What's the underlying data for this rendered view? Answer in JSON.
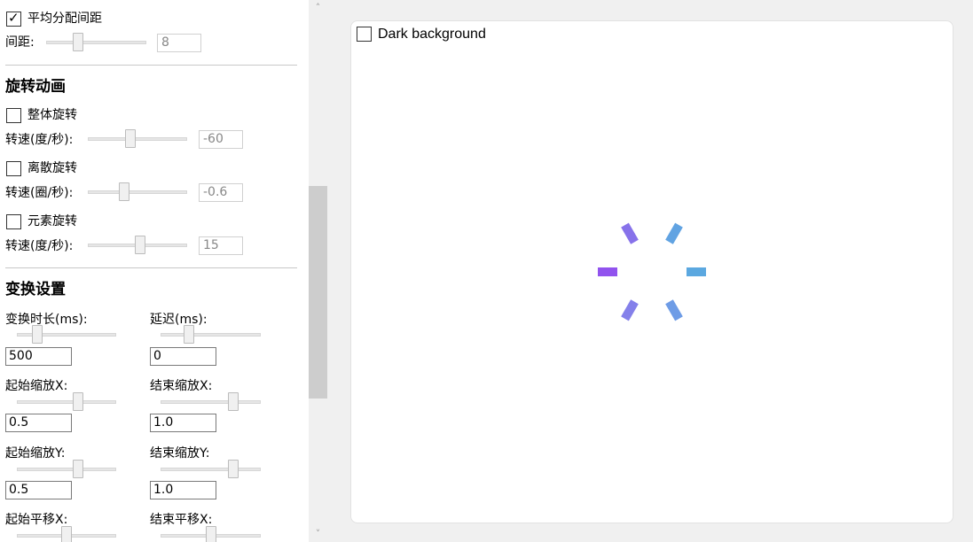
{
  "panel": {
    "even_spacing": {
      "label": "平均分配间距",
      "checked": true
    },
    "spacing": {
      "label": "间距:",
      "value": "8",
      "level": 0.3
    },
    "rotation_section": {
      "title": "旋转动画"
    },
    "whole_rotation": {
      "label": "整体旋转",
      "checked": false
    },
    "whole_speed": {
      "label": "转速(度/秒):",
      "value": "-60",
      "level": 0.42
    },
    "discrete_rotation": {
      "label": "离散旋转",
      "checked": false
    },
    "discrete_speed": {
      "label": "转速(圈/秒):",
      "value": "-0.6",
      "level": 0.35
    },
    "element_rotation": {
      "label": "元素旋转",
      "checked": false
    },
    "element_speed": {
      "label": "转速(度/秒):",
      "value": "15",
      "level": 0.53
    },
    "transform_section": {
      "title": "变换设置"
    },
    "duration": {
      "label": "变换时长(ms):",
      "value": "500",
      "level": 0.17
    },
    "delay": {
      "label": "延迟(ms):",
      "value": "0",
      "level": 0.26
    },
    "start_scale_x": {
      "label": "起始缩放X:",
      "value": "0.5",
      "level": 0.63
    },
    "end_scale_x": {
      "label": "结束缩放X:",
      "value": "1.0",
      "level": 0.75
    },
    "start_scale_y": {
      "label": "起始缩放Y:",
      "value": "0.5",
      "level": 0.63
    },
    "end_scale_y": {
      "label": "结束缩放Y:",
      "value": "1.0",
      "level": 0.75
    },
    "start_translate_x": {
      "label": "起始平移X:",
      "level": 0.5
    },
    "end_translate_x": {
      "label": "结束平移X:",
      "level": 0.5
    }
  },
  "scrollbar": {
    "up_icon": "chevron-up-icon",
    "down_icon": "chevron-down-icon"
  },
  "canvas": {
    "dark_background": {
      "label": "Dark background",
      "checked": false
    },
    "spinner": {
      "element_count": 6,
      "colors": [
        "#5BA8E0",
        "#6E9CE6",
        "#8480EA",
        "#9153EE",
        "#8772EA",
        "#61A3E2"
      ]
    }
  }
}
